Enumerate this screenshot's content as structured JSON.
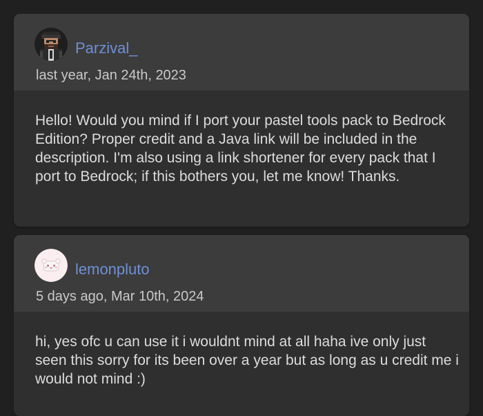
{
  "comments": [
    {
      "username": "Parzival_",
      "timestamp": "last year, Jan 24th, 2023",
      "avatar_icon": "pixel-character-avatar-icon",
      "text": "Hello! Would you mind if I port your pastel tools pack to Bedrock Edition? Proper credit and a Java link will be included in the description. I'm also using a link shortener for every pack that I port to Bedrock; if this bothers you, let me know! Thanks."
    },
    {
      "username": "lemonpluto",
      "timestamp": "5 days ago, Mar 10th, 2024",
      "avatar_icon": "pastel-creature-avatar-icon",
      "text": "hi, yes ofc u can use it i wouldnt mind at all haha ive only just seen this sorry for its been over a year but as long as u credit me i would not mind :)"
    }
  ],
  "colors": {
    "page_background": "#202020",
    "header_background": "#3c3c3c",
    "body_background": "#2f2f2f",
    "username": "#6f8fd6",
    "text": "#dcdcdc",
    "timestamp": "#c9c9c9"
  }
}
